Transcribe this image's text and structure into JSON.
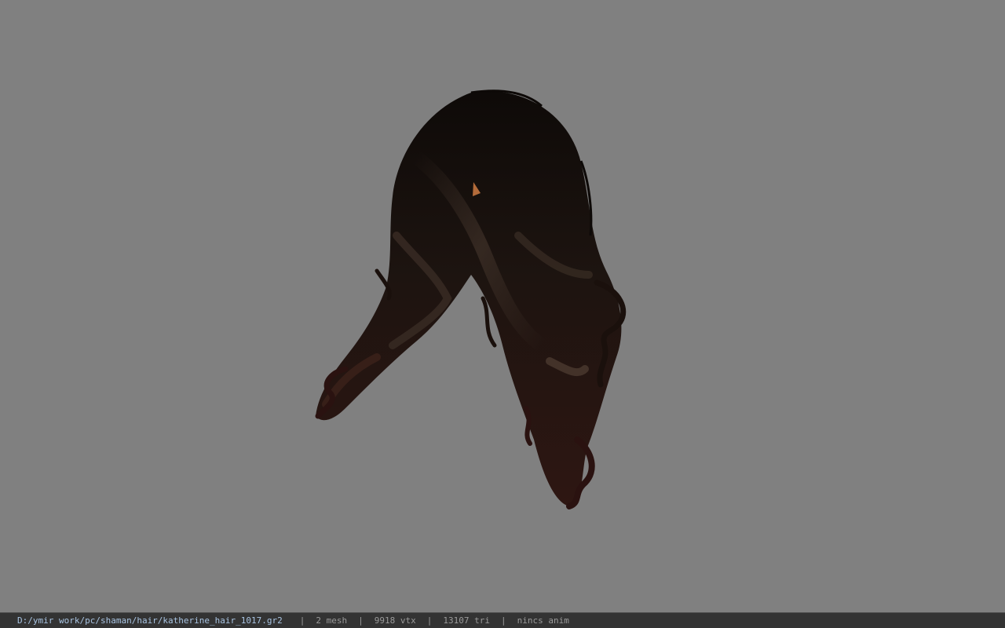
{
  "viewport": {
    "background_color": "#808080",
    "model": {
      "name": "hair-model",
      "colors": {
        "dark": "#120d0a",
        "mid": "#2a1d16",
        "highlight": "#4a3a30",
        "reddish": "#3a1a16",
        "skin": "#b36b3a"
      }
    }
  },
  "statusbar": {
    "path": "D:/ymir work/pc/shaman/hair/katherine_hair_1017.gr2",
    "separator": "|",
    "mesh": "2 mesh",
    "vertices": "9918 vtx",
    "triangles": "13107 tri",
    "animation": "nincs anim",
    "path_color": "#a9c4e2",
    "text_color": "#9a9a9a",
    "background_color": "#333333"
  }
}
